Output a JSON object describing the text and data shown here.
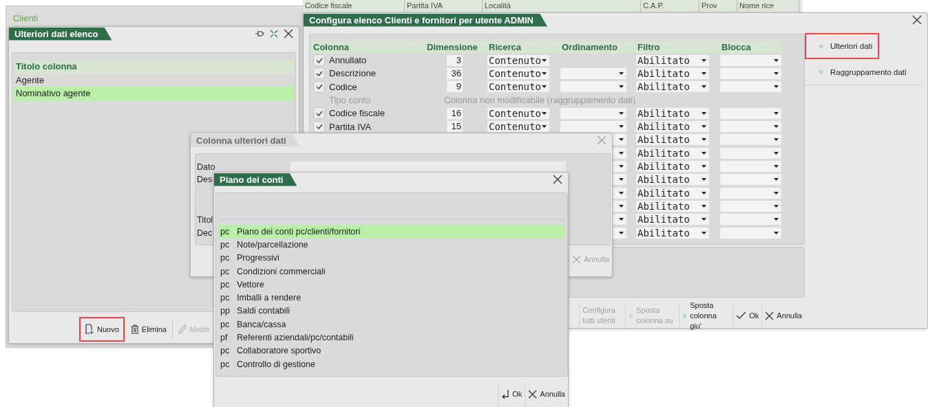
{
  "background_window": {
    "title": "Clienti",
    "columns": [
      "Codice fiscale",
      "Partita IVA",
      "Località",
      "C.A.P.",
      "Prov",
      "Nome rice"
    ]
  },
  "list_window": {
    "title": "Ulteriori dati elenco",
    "header": "Titolo colonna",
    "rows": [
      {
        "label": "Agente",
        "selected": false
      },
      {
        "label": "Nominativo agente",
        "selected": true
      }
    ],
    "buttons": [
      {
        "label": "Nuovo",
        "kind": "new",
        "disabled": false,
        "highlighted": true
      },
      {
        "label": "Elimina",
        "kind": "trash",
        "disabled": false,
        "highlighted": false
      },
      {
        "label": "Modifi",
        "kind": "pencil",
        "disabled": true,
        "highlighted": false
      }
    ]
  },
  "config_window": {
    "title": "Configura elenco Clienti e fornitori per utente ADMIN",
    "columns": [
      "Colonna",
      "Dimensione",
      "Ricerca",
      "Ordinamento",
      "Filtro",
      "Blocca"
    ],
    "rows": [
      {
        "kind": "column",
        "checked": true,
        "name": "Annullato",
        "size": "3",
        "search": "Contenuto",
        "sortable": false,
        "filter": "Abilitato"
      },
      {
        "kind": "column",
        "checked": true,
        "name": "Descrizione",
        "size": "36",
        "search": "Contenuto",
        "sortable": true,
        "filter": "Abilitato"
      },
      {
        "kind": "column",
        "checked": true,
        "name": "Codice",
        "size": "9",
        "search": "Contenuto",
        "sortable": true,
        "filter": "Abilitato"
      },
      {
        "kind": "fixed",
        "name": "Tipo conto",
        "note": "Colonna non modificabile (raggruppamento dati)"
      },
      {
        "kind": "column",
        "checked": true,
        "name": "Codice fiscale",
        "size": "16",
        "search": "Contenuto",
        "sortable": true,
        "filter": "Abilitato"
      },
      {
        "kind": "column",
        "checked": true,
        "name": "Partita IVA",
        "size": "15",
        "search": "Contenuto",
        "sortable": true,
        "filter": "Abilitato"
      },
      {
        "kind": "covered",
        "sortable": true,
        "filter": "Abilitato"
      },
      {
        "kind": "covered",
        "sortable": true,
        "filter": "Abilitato"
      },
      {
        "kind": "covered",
        "sortable": true,
        "filter": "Abilitato"
      },
      {
        "kind": "covered",
        "sortable": true,
        "filter": "Abilitato"
      },
      {
        "kind": "covered",
        "sortable": true,
        "filter": "Abilitato"
      },
      {
        "kind": "covered",
        "sortable": true,
        "filter": "Abilitato"
      },
      {
        "kind": "covered",
        "sortable": true,
        "filter": "Abilitato"
      },
      {
        "kind": "covered",
        "sortable": true,
        "filter": "Abilitato"
      }
    ],
    "toolbar": [
      {
        "label": "Configura tutti utenti",
        "kind": "none",
        "disabled": true
      },
      {
        "label": "Sposta colonna su",
        "kind": "dot",
        "disabled": true
      },
      {
        "label": "Sposta colonna giu'",
        "kind": "dot",
        "disabled": false
      },
      {
        "label": "Ok",
        "kind": "check",
        "disabled": false
      },
      {
        "label": "Annulla",
        "kind": "cross",
        "disabled": false
      }
    ],
    "sidebar": [
      {
        "label": "Ulteriori dati",
        "highlighted": true
      },
      {
        "label": "Raggruppamento dati",
        "highlighted": false
      }
    ]
  },
  "column_dialog": {
    "title": "Colonna ulteriori dati",
    "fields": [
      {
        "label": "Dato",
        "kind": "input"
      },
      {
        "label": "Des",
        "kind": "multiline"
      },
      {
        "label": "Titol",
        "kind": "line"
      },
      {
        "label": "Dec",
        "kind": "line"
      }
    ],
    "buttons": [
      {
        "label": "Annulla",
        "kind": "cross",
        "disabled": true
      }
    ]
  },
  "accounts_dialog": {
    "title": "Piano dei conti",
    "items": [
      {
        "code": "pc",
        "label": "Piano dei conti pc/clienti/fornitori",
        "selected": true
      },
      {
        "code": "pc",
        "label": "Note/parcellazione",
        "selected": false
      },
      {
        "code": "pc",
        "label": "Progressivi",
        "selected": false
      },
      {
        "code": "pc",
        "label": "Condizioni commerciali",
        "selected": false
      },
      {
        "code": "pc",
        "label": "Vettore",
        "selected": false
      },
      {
        "code": "pc",
        "label": "Imballi a rendere",
        "selected": false
      },
      {
        "code": "pp",
        "label": "Saldi contabili",
        "selected": false
      },
      {
        "code": "pc",
        "label": "Banca/cassa",
        "selected": false
      },
      {
        "code": "pf",
        "label": "Referenti aziendali/pc/contabili",
        "selected": false
      },
      {
        "code": "pc",
        "label": "Collaboratore sportivo",
        "selected": false
      },
      {
        "code": "pc",
        "label": "Controllo di gestione",
        "selected": false
      }
    ],
    "buttons": [
      {
        "label": "Ok",
        "kind": "return",
        "disabled": false
      },
      {
        "label": "Annulla",
        "kind": "cross",
        "disabled": false
      }
    ]
  }
}
